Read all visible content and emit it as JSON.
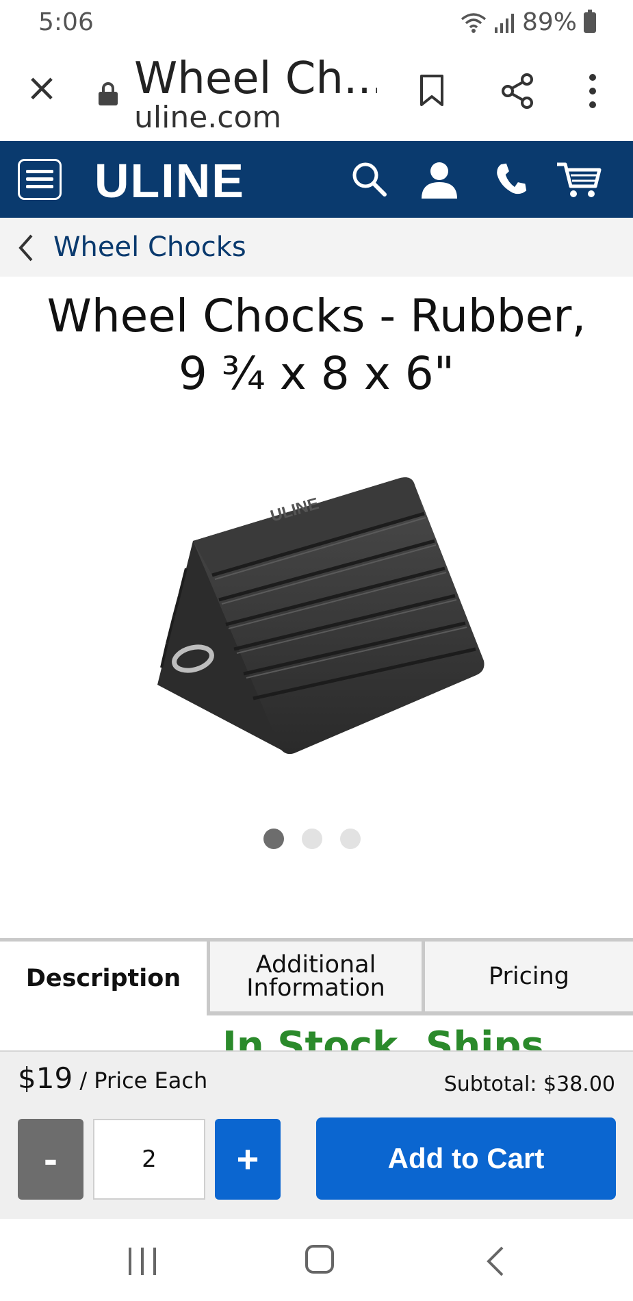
{
  "status_bar": {
    "time": "5:06",
    "battery": "89%",
    "icons": [
      "wifi-icon",
      "signal-icon",
      "battery-icon"
    ]
  },
  "browser": {
    "title": "Wheel Ch...",
    "url": "uline.com",
    "icons": [
      "close-icon",
      "lock-icon",
      "bookmark-icon",
      "share-icon",
      "more-vert-icon"
    ]
  },
  "site_header": {
    "logo": "ULINE",
    "background": "#0a3a6e",
    "icons": [
      "menu-icon",
      "search-icon",
      "account-icon",
      "phone-icon",
      "cart-icon"
    ]
  },
  "breadcrumb": {
    "label": "Wheel Chocks"
  },
  "product": {
    "title_line1": "Wheel Chocks - Rubber,",
    "title_line2": "9 ¾ x 8 x 6\"",
    "image_logo_text": "ULINE"
  },
  "carousel": {
    "count": 3,
    "active_index": 0
  },
  "tabs": [
    {
      "label": "Description",
      "active": true
    },
    {
      "label_line1": "Additional",
      "label_line2": "Information",
      "active": false
    },
    {
      "label": "Pricing",
      "active": false
    }
  ],
  "stock_status": "In Stock, Ships Today",
  "cart": {
    "price": "$19",
    "price_suffix": " / Price Each",
    "subtotal": "Subtotal: $38.00",
    "minus_label": "-",
    "quantity": "2",
    "plus_label": "+",
    "add_to_cart_label": "Add to Cart",
    "accent": "#0b66d0"
  },
  "nav_bar": {
    "icons": [
      "recent-apps-icon",
      "home-icon",
      "back-icon"
    ]
  }
}
